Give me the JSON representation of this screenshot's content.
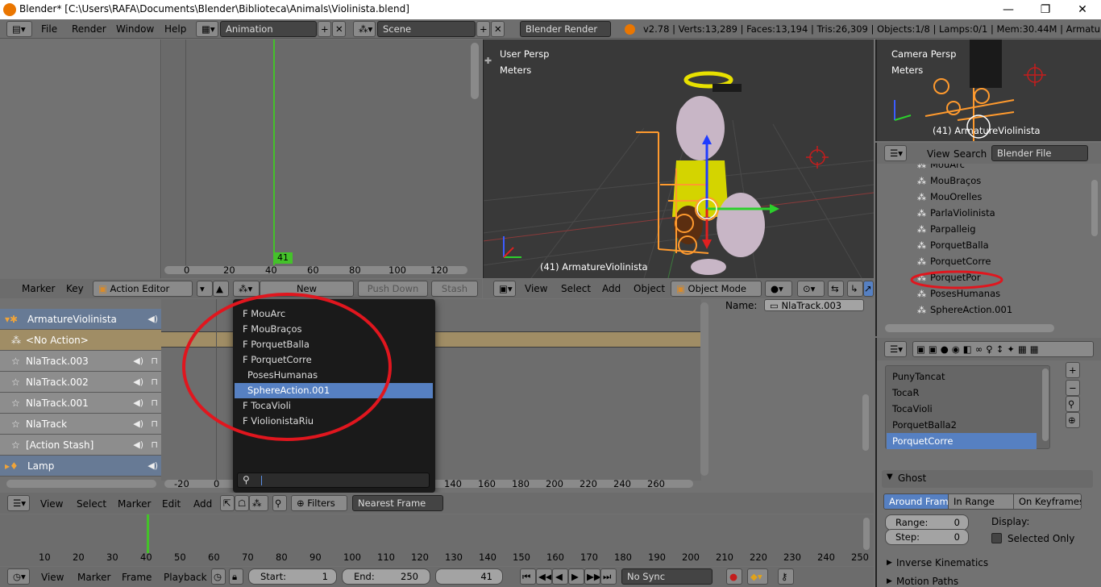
{
  "title": "Blender* [C:\\Users\\RAFA\\Documents\\Blender\\Biblioteca\\Animals\\Violinista.blend]",
  "topbar": {
    "menus": [
      "File",
      "Render",
      "Window",
      "Help"
    ],
    "layout": "Animation",
    "scene": "Scene",
    "engine": "Blender Render",
    "stats": "v2.78 | Verts:13,289 | Faces:13,194 | Tris:26,309 | Objects:1/8 | Lamps:0/1 | Mem:30.44M | ArmatureViolinista"
  },
  "graph": {
    "frame_badge": "41",
    "ticks": [
      "0",
      "20",
      "40",
      "60",
      "80",
      "100",
      "120"
    ]
  },
  "viewport_main": {
    "persp": "User Persp",
    "units": "Meters",
    "object": "(41) ArmatureViolinista",
    "menus": [
      "View",
      "Select",
      "Add",
      "Object"
    ],
    "mode": "Object Mode"
  },
  "viewport_cam": {
    "persp": "Camera Persp",
    "units": "Meters",
    "object": "(41) ArmatureViolinista"
  },
  "action_header": {
    "menus": [
      "Marker",
      "Key"
    ],
    "editor": "Action Editor",
    "new": "New",
    "push_down": "Push Down",
    "stash": "Stash"
  },
  "nla": {
    "rows": [
      {
        "label": "ArmatureViolinista",
        "kind": "object"
      },
      {
        "label": "<No Action>",
        "kind": "action"
      },
      {
        "label": "NlaTrack.003",
        "kind": "track"
      },
      {
        "label": "NlaTrack.002",
        "kind": "track"
      },
      {
        "label": "NlaTrack.001",
        "kind": "track"
      },
      {
        "label": "NlaTrack",
        "kind": "track"
      },
      {
        "label": "[Action Stash]",
        "kind": "track"
      },
      {
        "label": "Lamp",
        "kind": "object"
      }
    ],
    "name_label": "Name:",
    "name_value": "NlaTrack.003",
    "ticks": [
      "-20",
      "0",
      "140",
      "160",
      "180",
      "200",
      "220",
      "240",
      "260"
    ],
    "menus": [
      "View",
      "Select",
      "Marker",
      "Edit",
      "Add"
    ],
    "filters": "Filters",
    "snap": "Nearest Frame"
  },
  "action_popup": {
    "items": [
      "F MouArc",
      "F MouBraços",
      "F PorquetBalla",
      "F PorquetCorre",
      "PosesHumanas",
      "SphereAction.001",
      "F TocaVioli",
      "F ViolionistaRiu"
    ],
    "selected": 5
  },
  "outliner": {
    "menus": [
      "View",
      "Search"
    ],
    "filter": "Blender File",
    "items": [
      "MouArc",
      "MouBraços",
      "MouOrelles",
      "ParlaViolinista",
      "Parpalleig",
      "PorquetBalla",
      "PorquetCorre",
      "PorquetPor",
      "PosesHumanas",
      "SphereAction.001"
    ],
    "highlighted": 7
  },
  "properties": {
    "list": [
      "PunyTancat",
      "TocaR",
      "TocaVioli",
      "PorquetBalla2",
      "PorquetCorre"
    ],
    "selected": 4,
    "ghost": "Ghost",
    "ghost_tabs": [
      "Around Frame",
      "In Range",
      "On Keyframes"
    ],
    "range_label": "Range:",
    "range_value": "0",
    "step_label": "Step:",
    "step_value": "0",
    "display_label": "Display:",
    "selected_only": "Selected Only",
    "ik": "Inverse Kinematics",
    "motion_paths": "Motion Paths"
  },
  "dopesheet": {
    "ticks": [
      "10",
      "20",
      "30",
      "40",
      "50",
      "60",
      "70",
      "80",
      "90",
      "100",
      "110",
      "120",
      "130",
      "140",
      "150",
      "160",
      "170",
      "180",
      "190",
      "200",
      "210",
      "220",
      "230",
      "240",
      "250"
    ]
  },
  "timeline": {
    "menus": [
      "View",
      "Marker",
      "Frame",
      "Playback"
    ],
    "start_label": "Start:",
    "start": "1",
    "end_label": "End:",
    "end": "250",
    "current": "41",
    "sync": "No Sync"
  },
  "colors": {
    "accent": "#5680c2",
    "annotation": "#e0161e",
    "armature": "#ff9a2e",
    "green_frame": "#44c22a"
  }
}
